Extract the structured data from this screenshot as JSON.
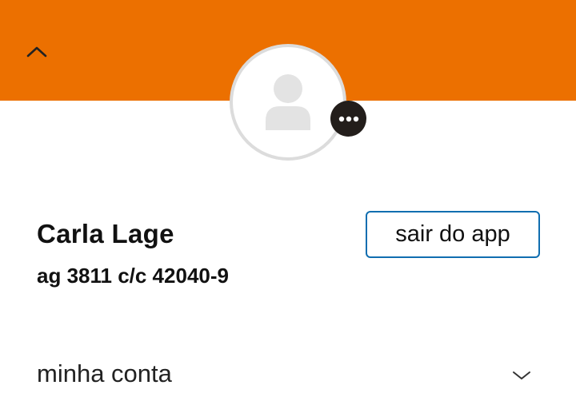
{
  "header": {
    "background_color": "#ec7000",
    "collapse_icon": "chevron-up-icon"
  },
  "profile": {
    "avatar_icon": "person-placeholder-icon",
    "more_icon": "more-horizontal-icon",
    "name": "Carla Lage",
    "account": "ag 3811 c/c 42040-9",
    "logout_label": "sair do app"
  },
  "menu": {
    "items": [
      {
        "label": "minha conta",
        "icon": "chevron-down-icon"
      }
    ]
  },
  "colors": {
    "accent": "#ec7000",
    "button_border": "#106eb0",
    "text": "#111111"
  }
}
